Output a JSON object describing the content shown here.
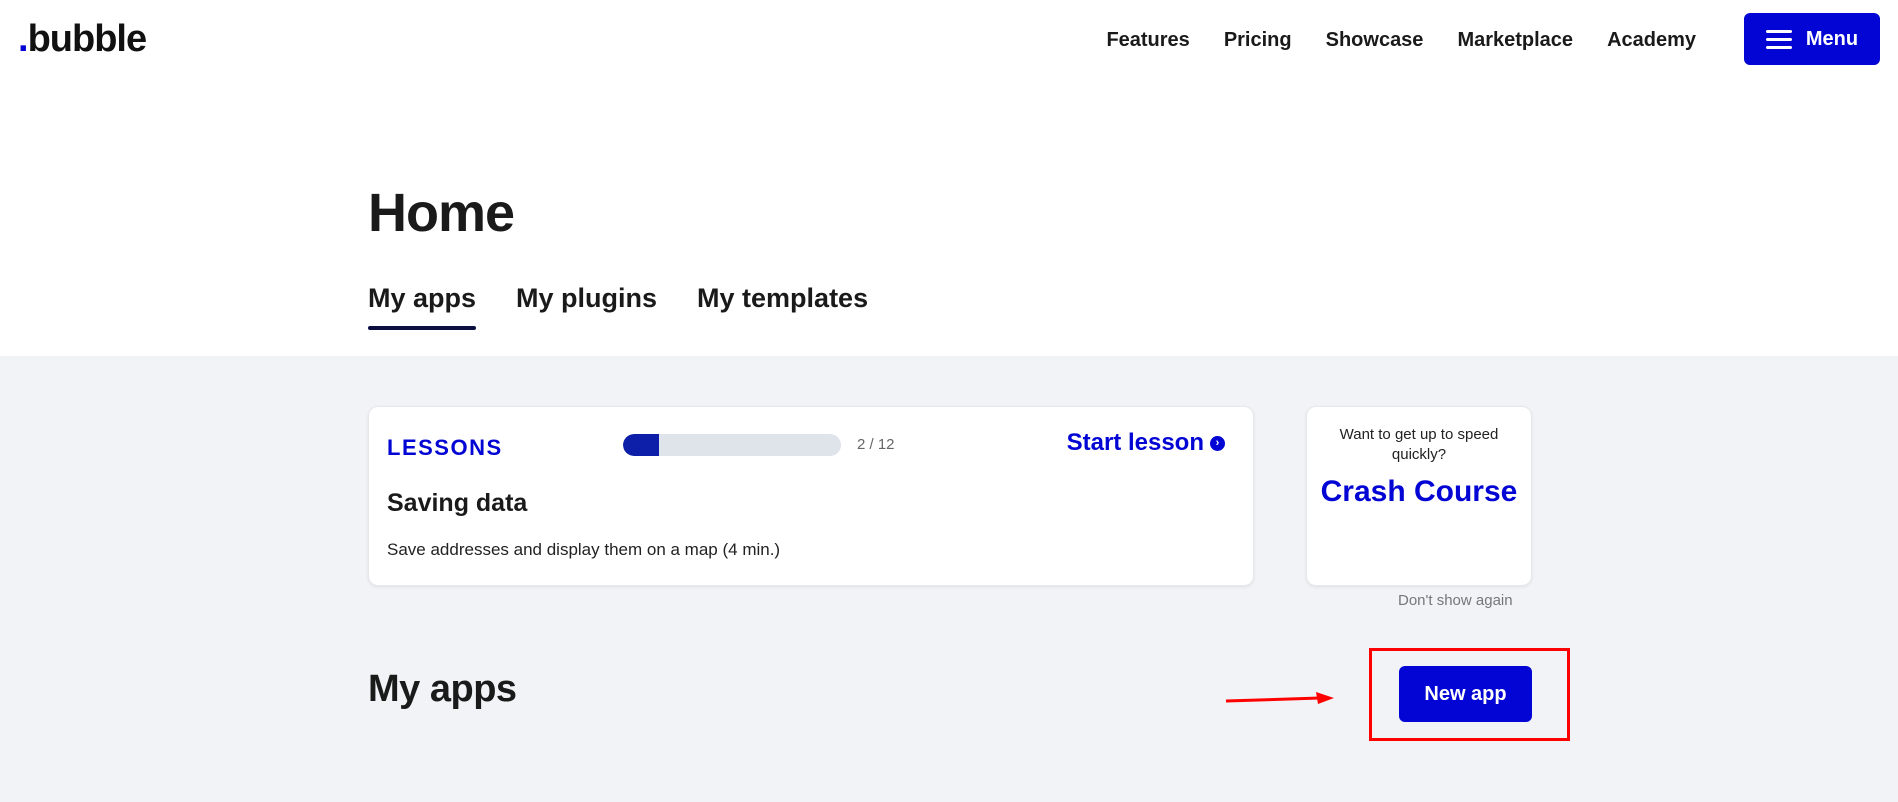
{
  "brand": {
    "logo_text": "bubble",
    "accent": "#0205d3"
  },
  "nav": {
    "links": [
      "Features",
      "Pricing",
      "Showcase",
      "Marketplace",
      "Academy"
    ],
    "menu_label": "Menu"
  },
  "header": {
    "title": "Home",
    "tabs": [
      {
        "label": "My apps",
        "active": true
      },
      {
        "label": "My plugins",
        "active": false
      },
      {
        "label": "My templates",
        "active": false
      }
    ]
  },
  "lessons": {
    "label": "LESSONS",
    "progress_text": "2 / 12",
    "progress_fraction": 0.167,
    "start_label": "Start lesson",
    "title": "Saving data",
    "description": "Save addresses and display them on a map (4 min.)"
  },
  "crash_course": {
    "subtitle": "Want to get up to speed quickly?",
    "title": "Crash Course",
    "dismiss_label": "Don't show again"
  },
  "apps": {
    "section_title": "My apps",
    "new_app_label": "New app"
  },
  "annotation": {
    "color": "#ff0000"
  }
}
